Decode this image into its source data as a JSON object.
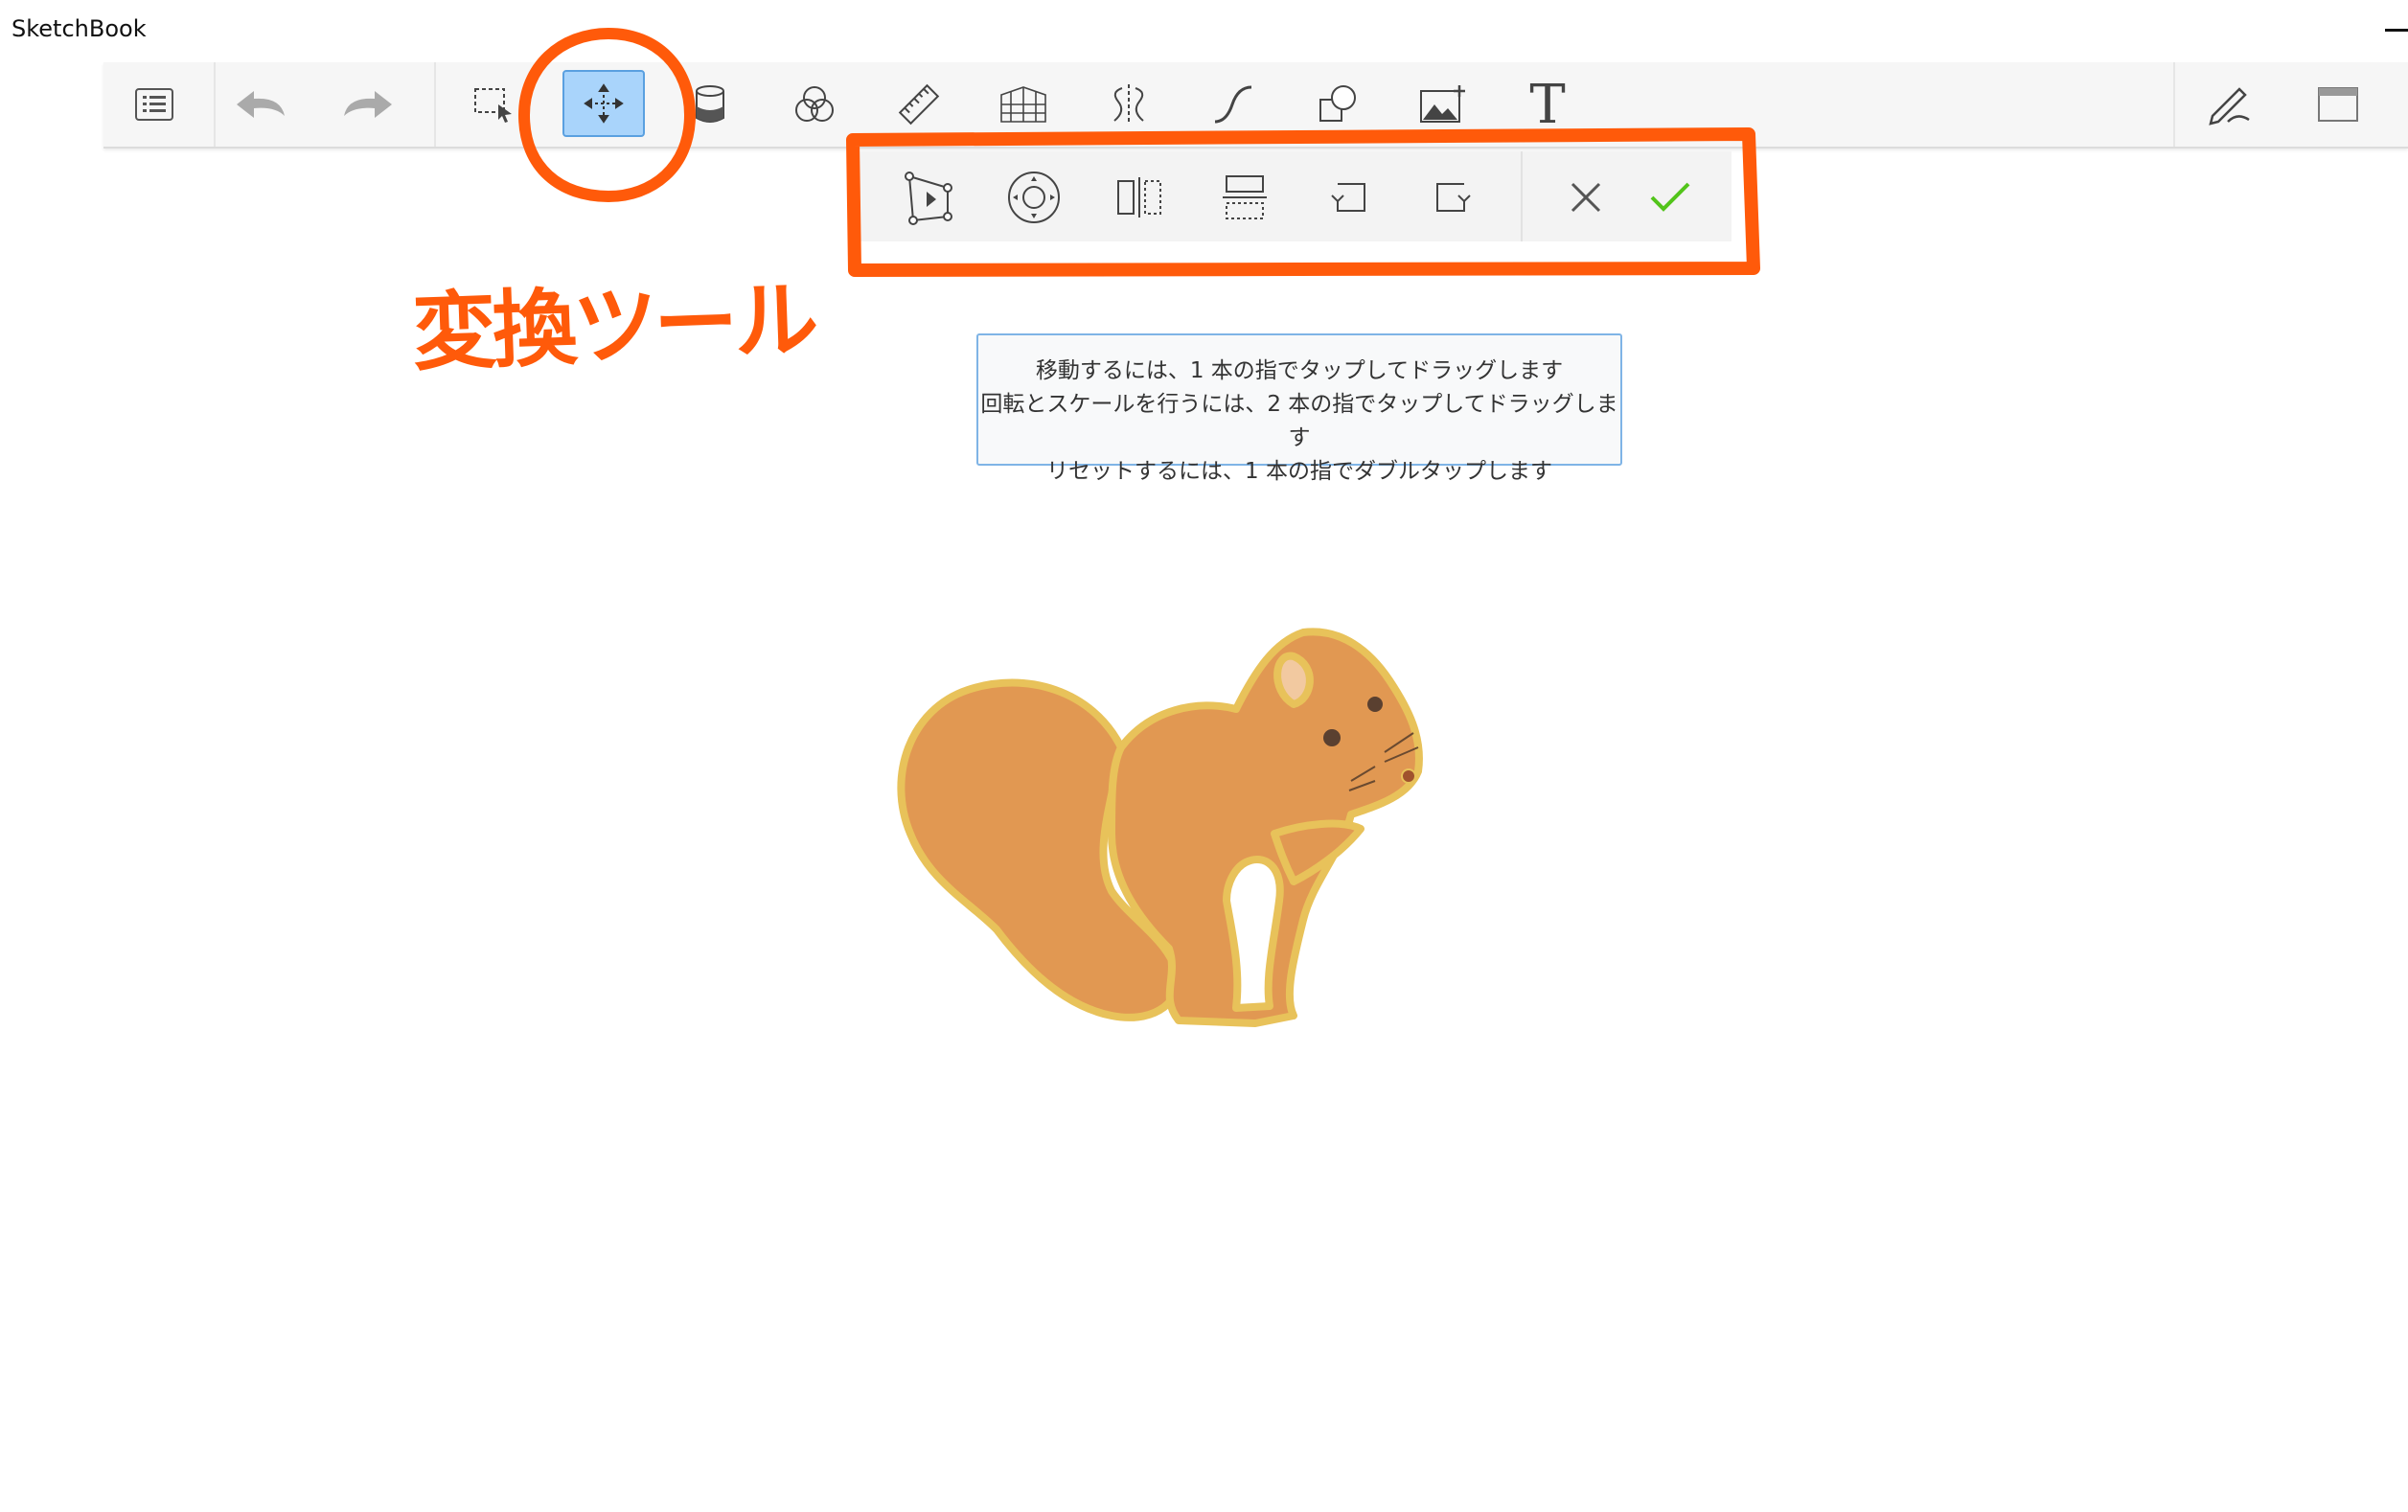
{
  "window": {
    "title": "SketchBook"
  },
  "toolbar": {
    "tools": [
      {
        "id": "menu",
        "icon": "list-icon"
      },
      {
        "id": "undo",
        "icon": "undo-icon"
      },
      {
        "id": "redo",
        "icon": "redo-icon"
      },
      {
        "id": "select",
        "icon": "selection-icon"
      },
      {
        "id": "transform",
        "icon": "move-arrows-icon",
        "active": true
      },
      {
        "id": "fill",
        "icon": "paint-bucket-icon"
      },
      {
        "id": "color",
        "icon": "color-circles-icon"
      },
      {
        "id": "ruler",
        "icon": "ruler-icon"
      },
      {
        "id": "perspective",
        "icon": "perspective-grid-icon"
      },
      {
        "id": "symmetry",
        "icon": "symmetry-icon"
      },
      {
        "id": "curve",
        "icon": "curve-icon"
      },
      {
        "id": "shapes",
        "icon": "shapes-icon"
      },
      {
        "id": "image",
        "icon": "add-image-icon"
      },
      {
        "id": "text",
        "icon": "text-icon",
        "label": "T"
      },
      {
        "id": "pen",
        "icon": "pen-icon"
      },
      {
        "id": "window",
        "icon": "window-icon"
      }
    ]
  },
  "transform_bar": {
    "tools": [
      {
        "id": "distort",
        "icon": "distort-icon"
      },
      {
        "id": "pivot",
        "icon": "pivot-icon"
      },
      {
        "id": "flip-h",
        "icon": "flip-horizontal-icon"
      },
      {
        "id": "flip-v",
        "icon": "flip-vertical-icon"
      },
      {
        "id": "rotate-ccw",
        "icon": "rotate-left-icon"
      },
      {
        "id": "rotate-cw",
        "icon": "rotate-right-icon"
      },
      {
        "id": "cancel",
        "icon": "close-icon"
      },
      {
        "id": "confirm",
        "icon": "check-icon"
      }
    ]
  },
  "tooltip": {
    "line1": "移動するには、1 本の指でタップしてドラッグします",
    "line2": "回転とスケールを行うには、2 本の指でタップしてドラッグします",
    "line3": "リセットするには、1 本の指でダブルタップします"
  },
  "annotation": {
    "text": "変換ツール"
  },
  "colors": {
    "annotation": "#ff5a0a",
    "active_tool": "#a9d4fb",
    "confirm": "#52c41a",
    "squirrel": "#e19852",
    "squirrel_outline": "#e8c25a"
  }
}
